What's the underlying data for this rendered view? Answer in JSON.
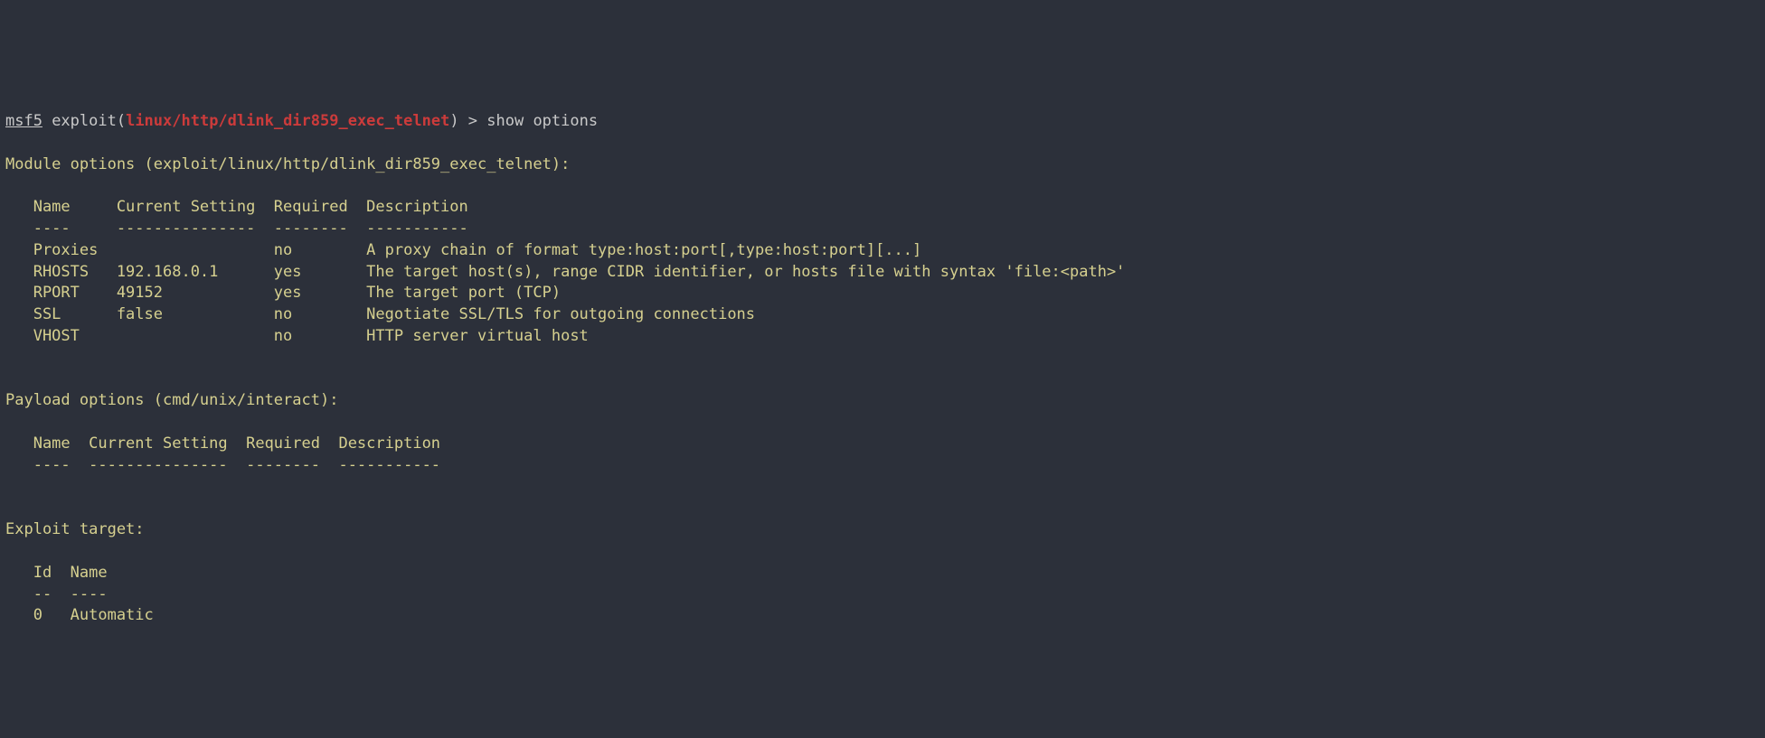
{
  "prompt": {
    "msf": "msf5",
    "exploit_word": " exploit(",
    "path": "linux/http/dlink_dir859_exec_telnet",
    "close": ") > ",
    "command": "show options"
  },
  "module_header": "Module options (exploit/linux/http/dlink_dir859_exec_telnet):",
  "module_table": {
    "h1": "   Name     Current Setting  Required  Description",
    "h2": "   ----     ---------------  --------  -----------",
    "r1": "   Proxies                   no        A proxy chain of format type:host:port[,type:host:port][...]",
    "r2": "   RHOSTS   192.168.0.1      yes       The target host(s), range CIDR identifier, or hosts file with syntax 'file:<path>'",
    "r3": "   RPORT    49152            yes       The target port (TCP)",
    "r4": "   SSL      false            no        Negotiate SSL/TLS for outgoing connections",
    "r5": "   VHOST                     no        HTTP server virtual host"
  },
  "payload_header": "Payload options (cmd/unix/interact):",
  "payload_table": {
    "h1": "   Name  Current Setting  Required  Description",
    "h2": "   ----  ---------------  --------  -----------"
  },
  "target_header": "Exploit target:",
  "target_table": {
    "h1": "   Id  Name",
    "h2": "   --  ----",
    "r1": "   0   Automatic"
  }
}
